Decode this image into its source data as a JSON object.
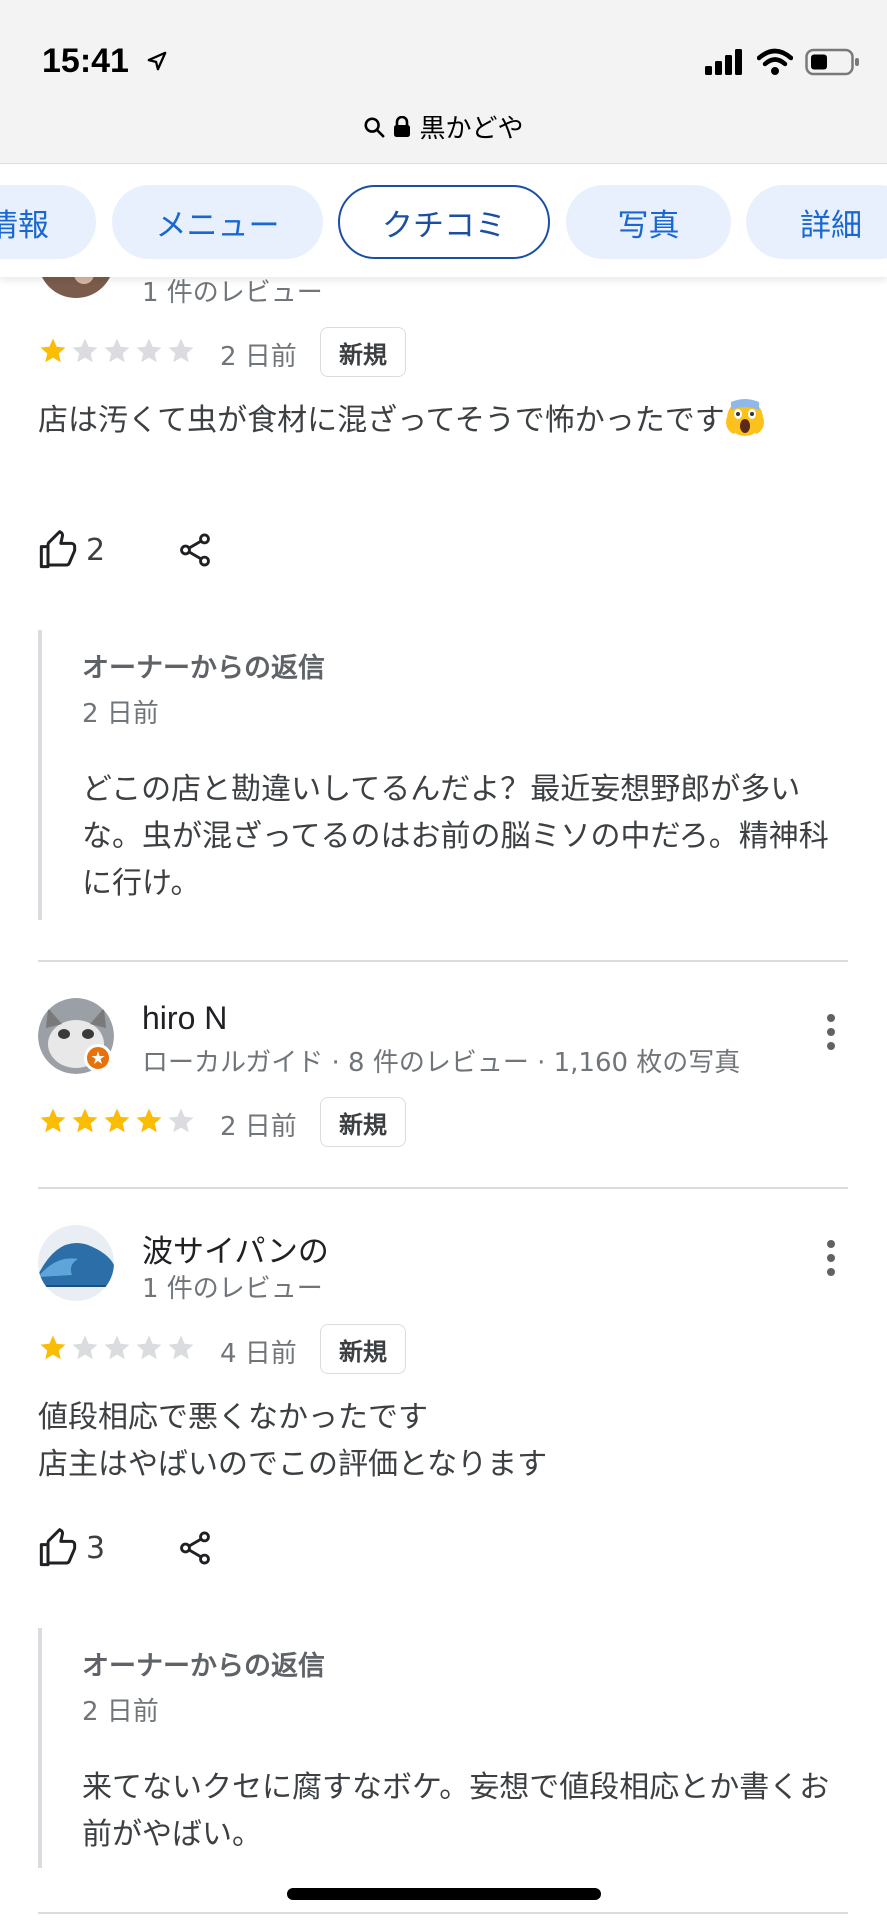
{
  "status_bar": {
    "time": "15:41",
    "url_text": "黒かどや"
  },
  "tabs": [
    {
      "label": "情報",
      "active": false
    },
    {
      "label": "メニュー",
      "active": false
    },
    {
      "label": "クチコミ",
      "active": true
    },
    {
      "label": "写真",
      "active": false
    },
    {
      "label": "詳細",
      "active": false
    }
  ],
  "reviews": [
    {
      "reviewer_meta": "1 件のレビュー",
      "rating": 1,
      "date": "2 日前",
      "badge": "新規",
      "text": "店は汚くて虫が食材に混ざってそうで怖かったです",
      "likes": "2",
      "owner_reply": {
        "title": "オーナーからの返信",
        "date": "2 日前",
        "text": "どこの店と勘違いしてるんだよ？最近妄想野郎が多いな。虫が混ざってるのはお前の脳ミソの中だろ。精神科に行け。"
      }
    },
    {
      "reviewer_name": "hiro N",
      "reviewer_meta": "ローカルガイド · 8 件のレビュー · 1,160 枚の写真",
      "rating": 4,
      "date": "2 日前",
      "badge": "新規"
    },
    {
      "reviewer_name": "波サイパンの",
      "reviewer_meta": "1 件のレビュー",
      "rating": 1,
      "date": "4 日前",
      "badge": "新規",
      "text_line1": "値段相応で悪くなかったです",
      "text_line2": "店主はやばいのでこの評価となります",
      "likes": "3",
      "owner_reply": {
        "title": "オーナーからの返信",
        "date": "2 日前",
        "text": "来てないクセに腐すなボケ。妄想で値段相応とか書くお前がやばい。"
      }
    }
  ],
  "colors": {
    "accent": "#1a73e8",
    "tab_bg": "#e8f0fe",
    "star_filled": "#fbbc04",
    "star_empty": "#dadce0"
  }
}
